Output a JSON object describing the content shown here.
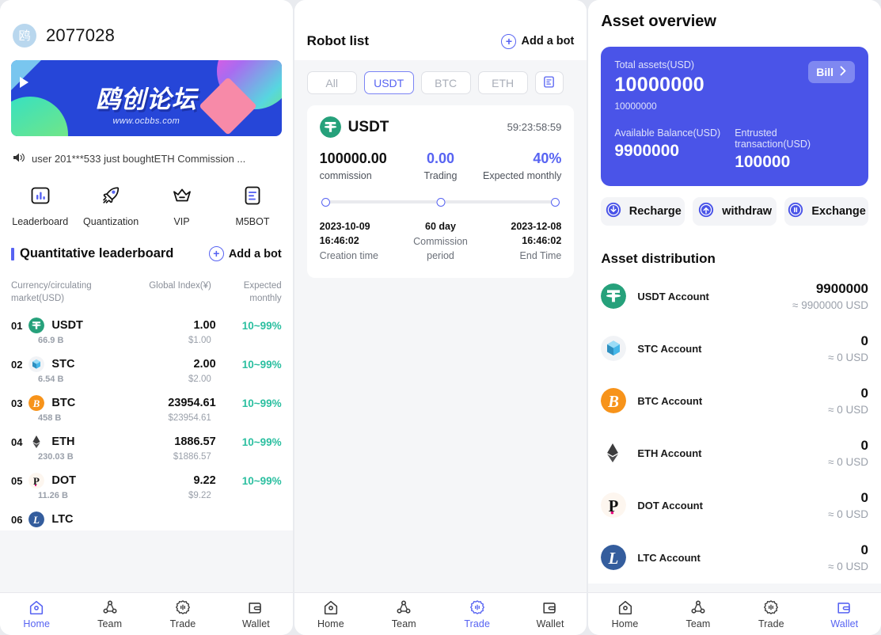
{
  "left": {
    "user_id": "2077028",
    "avatar_glyph": "鸥",
    "banner": {
      "title": "鸥创论坛",
      "url": "www.ocbbs.com"
    },
    "notice": {
      "icon": "speaker-icon",
      "text": "user 201***533 just boughtETH Commission ..."
    },
    "quicknav": [
      {
        "label": "Leaderboard",
        "icon": "bar-chart-icon"
      },
      {
        "label": "Quantization",
        "icon": "rocket-icon"
      },
      {
        "label": "VIP",
        "icon": "crown-icon"
      },
      {
        "label": "M5BOT",
        "icon": "document-icon"
      }
    ],
    "section": {
      "title": "Quantitative leaderboard",
      "add_bot": "Add a bot"
    },
    "table": {
      "headers": [
        "Currency/circulating market(USD)",
        "Global Index(¥)",
        "Expected monthly"
      ],
      "rows": [
        {
          "rank": "01",
          "symbol": "USDT",
          "cap": "66.9 B",
          "index": "1.00",
          "usd": "$1.00",
          "expected": "10~99%"
        },
        {
          "rank": "02",
          "symbol": "STC",
          "cap": "6.54 B",
          "index": "2.00",
          "usd": "$2.00",
          "expected": "10~99%"
        },
        {
          "rank": "03",
          "symbol": "BTC",
          "cap": "458 B",
          "index": "23954.61",
          "usd": "$23954.61",
          "expected": "10~99%"
        },
        {
          "rank": "04",
          "symbol": "ETH",
          "cap": "230.03 B",
          "index": "1886.57",
          "usd": "$1886.57",
          "expected": "10~99%"
        },
        {
          "rank": "05",
          "symbol": "DOT",
          "cap": "11.26 B",
          "index": "9.22",
          "usd": "$9.22",
          "expected": "10~99%"
        },
        {
          "rank": "06",
          "symbol": "LTC",
          "cap": "",
          "index": "",
          "usd": "",
          "expected": ""
        }
      ]
    },
    "tabbar": [
      {
        "label": "Home",
        "icon": "home-icon",
        "active": true
      },
      {
        "label": "Team",
        "icon": "team-icon",
        "active": false
      },
      {
        "label": "Trade",
        "icon": "trade-icon",
        "active": false
      },
      {
        "label": "Wallet",
        "icon": "wallet-icon",
        "active": false
      }
    ]
  },
  "middle": {
    "title": "Robot list",
    "add_bot": "Add a bot",
    "filters": [
      {
        "label": "All",
        "selected": false
      },
      {
        "label": "USDT",
        "selected": true
      },
      {
        "label": "BTC",
        "selected": false
      },
      {
        "label": "ETH",
        "selected": false
      }
    ],
    "filter_icon": "list-filter-icon",
    "bot": {
      "symbol": "USDT",
      "timer": "59:23:58:59",
      "stats": [
        {
          "value": "100000.00",
          "label": "commission",
          "accent": false
        },
        {
          "value": "0.00",
          "label": "Trading",
          "accent": true
        },
        {
          "value": "40%",
          "label": "Expected monthly",
          "accent": true
        }
      ],
      "times": [
        {
          "value": "2023-10-09 16:46:02",
          "label": "Creation time"
        },
        {
          "value": "60 day",
          "label": "Commission period"
        },
        {
          "value": "2023-12-08 16:46:02",
          "label": "End Time"
        }
      ]
    },
    "tabbar": [
      {
        "label": "Home",
        "icon": "home-icon",
        "active": false
      },
      {
        "label": "Team",
        "icon": "team-icon",
        "active": false
      },
      {
        "label": "Trade",
        "icon": "trade-icon",
        "active": true
      },
      {
        "label": "Wallet",
        "icon": "wallet-icon",
        "active": false
      }
    ]
  },
  "right": {
    "title": "Asset overview",
    "card": {
      "total_label": "Total assets(USD)",
      "total_value": "10000000",
      "total_sub": "10000000",
      "bill_label": "Bill",
      "available_label": "Available Balance(USD)",
      "available_value": "9900000",
      "entrusted_label": "Entrusted transaction(USD)",
      "entrusted_value": "100000"
    },
    "actions": [
      {
        "label": "Recharge",
        "icon": "download-circle-icon"
      },
      {
        "label": "withdraw",
        "icon": "upload-circle-icon"
      },
      {
        "label": "Exchange",
        "icon": "pause-circle-icon"
      }
    ],
    "distribution_title": "Asset distribution",
    "accounts": [
      {
        "name": "USDT Account",
        "amount": "9900000",
        "usd": "≈ 9900000 USD"
      },
      {
        "name": "STC Account",
        "amount": "0",
        "usd": "≈ 0 USD"
      },
      {
        "name": "BTC Account",
        "amount": "0",
        "usd": "≈ 0 USD"
      },
      {
        "name": "ETH Account",
        "amount": "0",
        "usd": "≈ 0 USD"
      },
      {
        "name": "DOT Account",
        "amount": "0",
        "usd": "≈ 0 USD"
      },
      {
        "name": "LTC Account",
        "amount": "0",
        "usd": "≈ 0 USD"
      }
    ],
    "tabbar": [
      {
        "label": "Home",
        "icon": "home-icon",
        "active": false
      },
      {
        "label": "Team",
        "icon": "team-icon",
        "active": false
      },
      {
        "label": "Trade",
        "icon": "trade-icon",
        "active": false
      },
      {
        "label": "Wallet",
        "icon": "wallet-icon",
        "active": true
      }
    ]
  },
  "colors": {
    "accent": "#5763f2",
    "card_blue": "#4a54e8",
    "green": "#2bbfa0",
    "usdt": "#26a17b",
    "btc": "#f7931a",
    "eth": "#3c3c3d",
    "dot": "#e6007a",
    "ltc": "#345d9d",
    "stc": "#45b6e8"
  }
}
